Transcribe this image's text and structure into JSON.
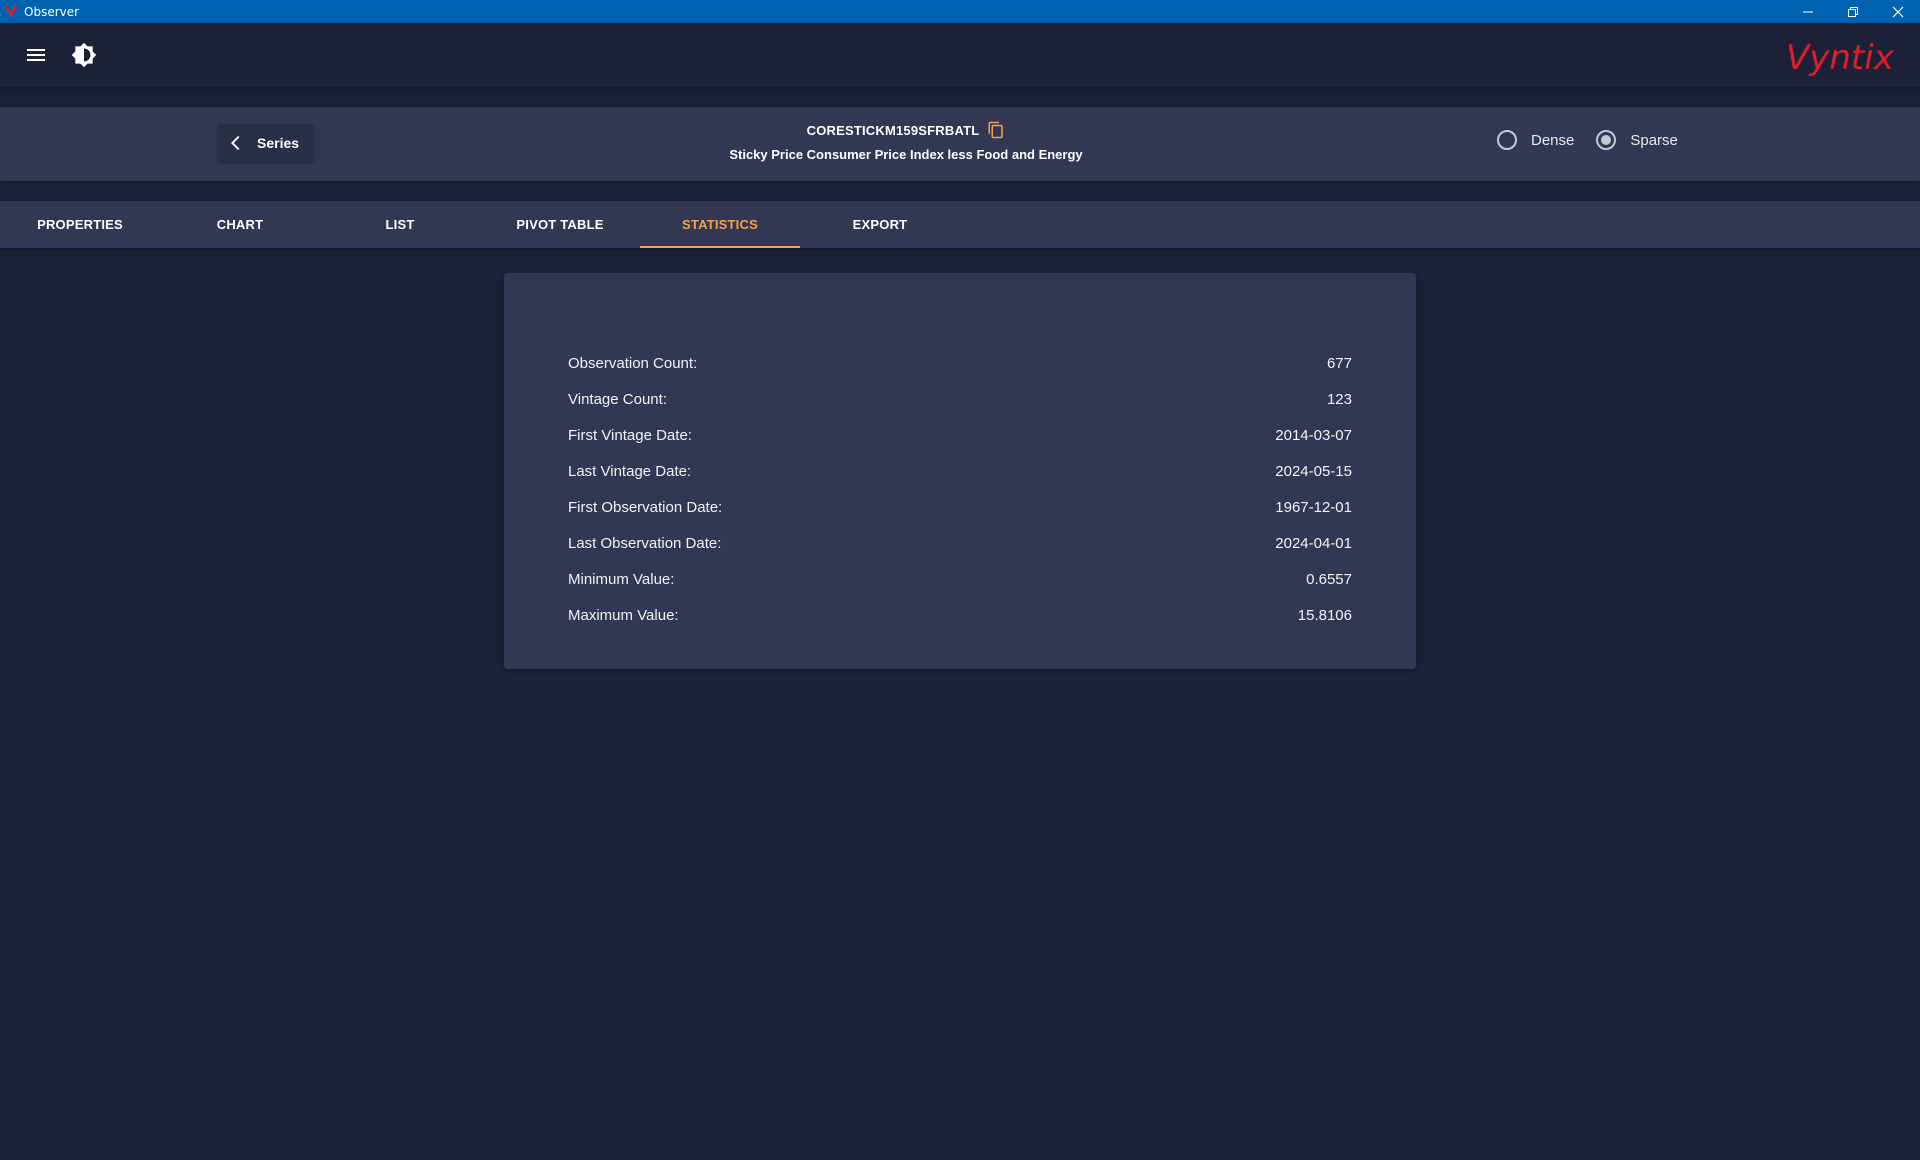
{
  "window": {
    "title": "Observer"
  },
  "brand": {
    "logo_text": "Vyntix",
    "color": "#e01e2b"
  },
  "appbar": {
    "menu_icon": "hamburger-menu-icon",
    "theme_icon": "brightness-icon"
  },
  "series": {
    "back_label": "Series",
    "id": "CORESTICKM159SFRBATL",
    "description": "Sticky Price Consumer Price Index less Food and Energy",
    "modes": [
      {
        "label": "Dense",
        "selected": false
      },
      {
        "label": "Sparse",
        "selected": true
      }
    ]
  },
  "tabs": [
    {
      "label": "PROPERTIES",
      "active": false
    },
    {
      "label": "CHART",
      "active": false
    },
    {
      "label": "LIST",
      "active": false
    },
    {
      "label": "PIVOT TABLE",
      "active": false
    },
    {
      "label": "STATISTICS",
      "active": true
    },
    {
      "label": "EXPORT",
      "active": false
    }
  ],
  "statistics": [
    {
      "label": "Observation Count:",
      "value": "677"
    },
    {
      "label": "Vintage Count:",
      "value": "123"
    },
    {
      "label": "First Vintage Date:",
      "value": "2014-03-07"
    },
    {
      "label": "Last Vintage Date:",
      "value": "2024-05-15"
    },
    {
      "label": "First Observation Date:",
      "value": "1967-12-01"
    },
    {
      "label": "Last Observation Date:",
      "value": "2024-04-01"
    },
    {
      "label": "Minimum Value:",
      "value": "0.6557"
    },
    {
      "label": "Maximum Value:",
      "value": "15.8106"
    }
  ],
  "colors": {
    "background": "#1c2138",
    "panel": "#323753",
    "accent": "#f2a24a",
    "titlebar": "#0063b1"
  }
}
